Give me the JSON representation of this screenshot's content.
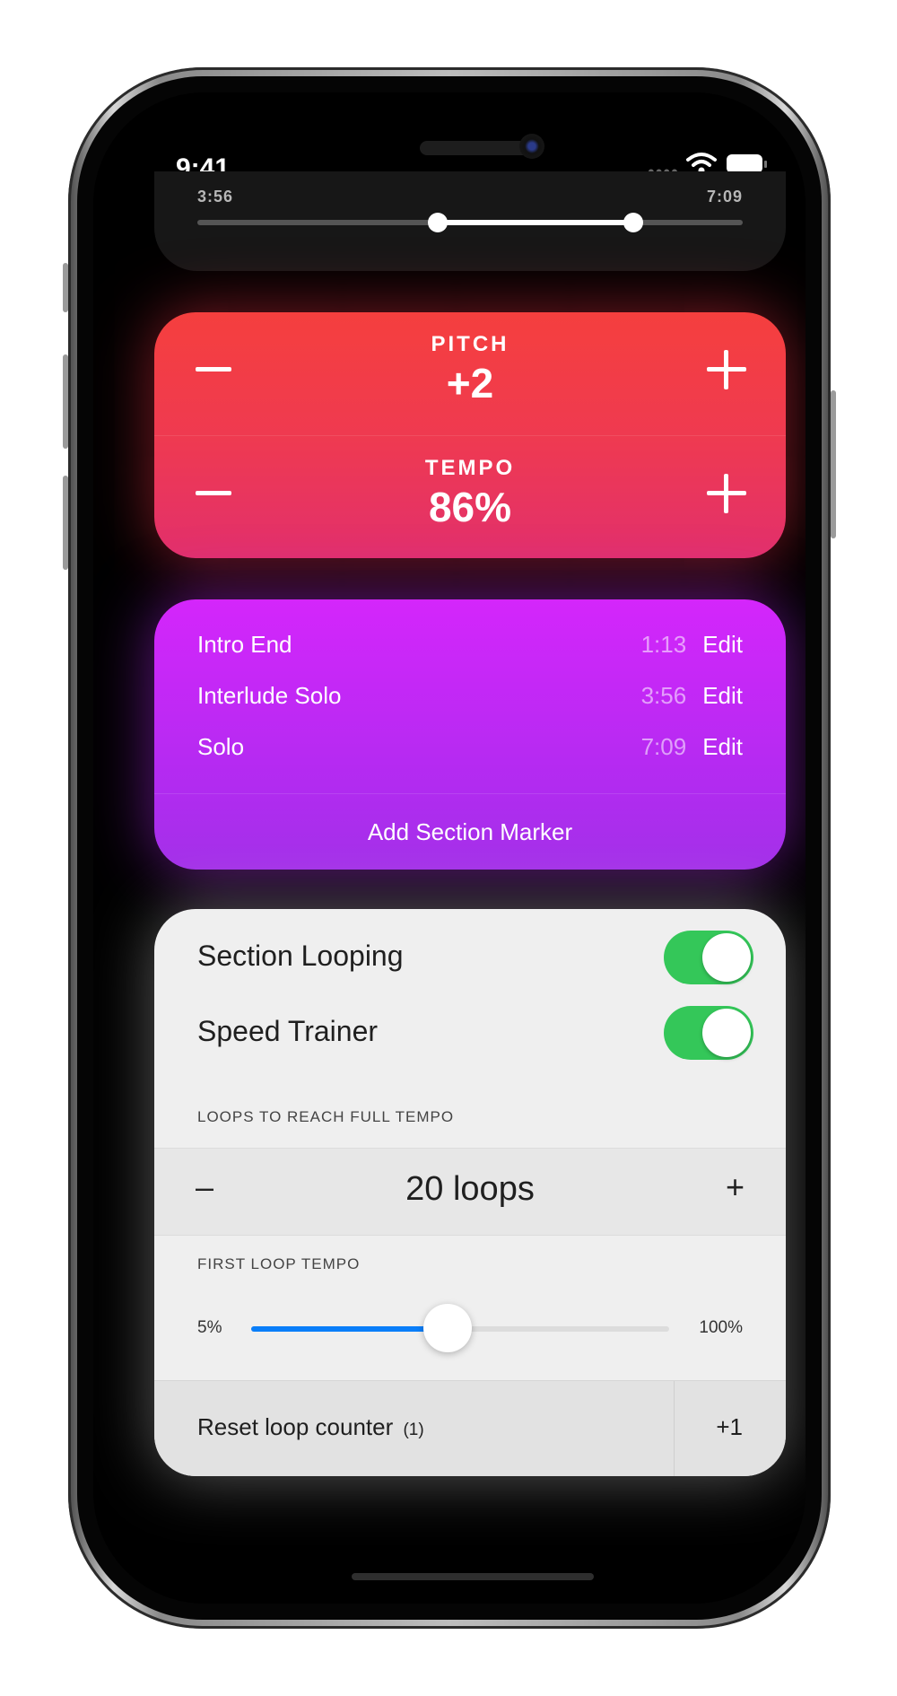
{
  "status": {
    "time": "9:41",
    "signal_dots": "••••"
  },
  "scrubber": {
    "start_time": "3:56",
    "end_time": "7:09",
    "loop_start_fraction": 0.44,
    "loop_end_fraction": 0.8
  },
  "pitch": {
    "label": "PITCH",
    "value": "+2"
  },
  "tempo": {
    "label": "TEMPO",
    "value": "86%"
  },
  "markers": {
    "items": [
      {
        "name": "Intro End",
        "time": "1:13",
        "edit": "Edit"
      },
      {
        "name": "Interlude Solo",
        "time": "3:56",
        "edit": "Edit"
      },
      {
        "name": "Solo",
        "time": "7:09",
        "edit": "Edit"
      }
    ],
    "add_label": "Add Section Marker"
  },
  "settings": {
    "section_looping": {
      "label": "Section Looping",
      "on": true
    },
    "speed_trainer": {
      "label": "Speed Trainer",
      "on": true
    },
    "loops_caption": "LOOPS TO REACH FULL TEMPO",
    "stepper": {
      "minus": "–",
      "value": "20 loops",
      "plus": "+"
    },
    "first_tempo_caption": "FIRST LOOP TEMPO",
    "slider": {
      "min_label": "5%",
      "max_label": "100%",
      "fraction": 0.47
    },
    "reset": {
      "label": "Reset loop counter",
      "count": "(1)",
      "increment": "+1"
    }
  },
  "colors": {
    "pitch_top": "#f53f3e",
    "pitch_bottom": "#e2306c",
    "markers_top": "#d426fb",
    "markers_bottom": "#a331e8",
    "toggle_on": "#34c759",
    "slider_fill": "#0a7ef9"
  },
  "icons": [
    "wifi-icon",
    "battery-icon",
    "minus-icon",
    "plus-icon"
  ]
}
